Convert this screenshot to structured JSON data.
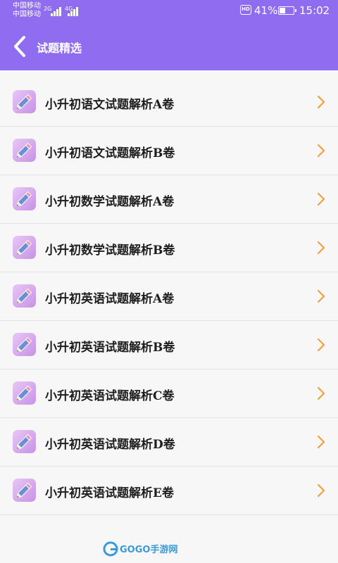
{
  "status_bar": {
    "carrier_1": "中国移动",
    "carrier_2": "中国移动",
    "sim1_net": "2G",
    "sim2_net": "4G",
    "hd": "HD",
    "battery_percent": "41%",
    "battery_level": 0.41,
    "time": "15:02"
  },
  "header": {
    "title": "试题精选",
    "back_icon": "chevron-left-icon"
  },
  "list": {
    "items": [
      {
        "label": "小升初语文试题解析A卷"
      },
      {
        "label": "小升初语文试题解析B卷"
      },
      {
        "label": "小升初数学试题解析A卷"
      },
      {
        "label": "小升初数学试题解析B卷"
      },
      {
        "label": "小升初英语试题解析A卷"
      },
      {
        "label": "小升初英语试题解析B卷"
      },
      {
        "label": "小升初英语试题解析C卷"
      },
      {
        "label": "小升初英语试题解析D卷"
      },
      {
        "label": "小升初英语试题解析E卷"
      }
    ],
    "item_icon": "pencil-icon",
    "chevron_icon": "chevron-right-icon"
  },
  "watermark": {
    "text": "GOGO手游网"
  },
  "colors": {
    "header_bg": "#8f6cf0",
    "chevron": "#f0a040",
    "icon_bg": "#d9a9ef"
  }
}
